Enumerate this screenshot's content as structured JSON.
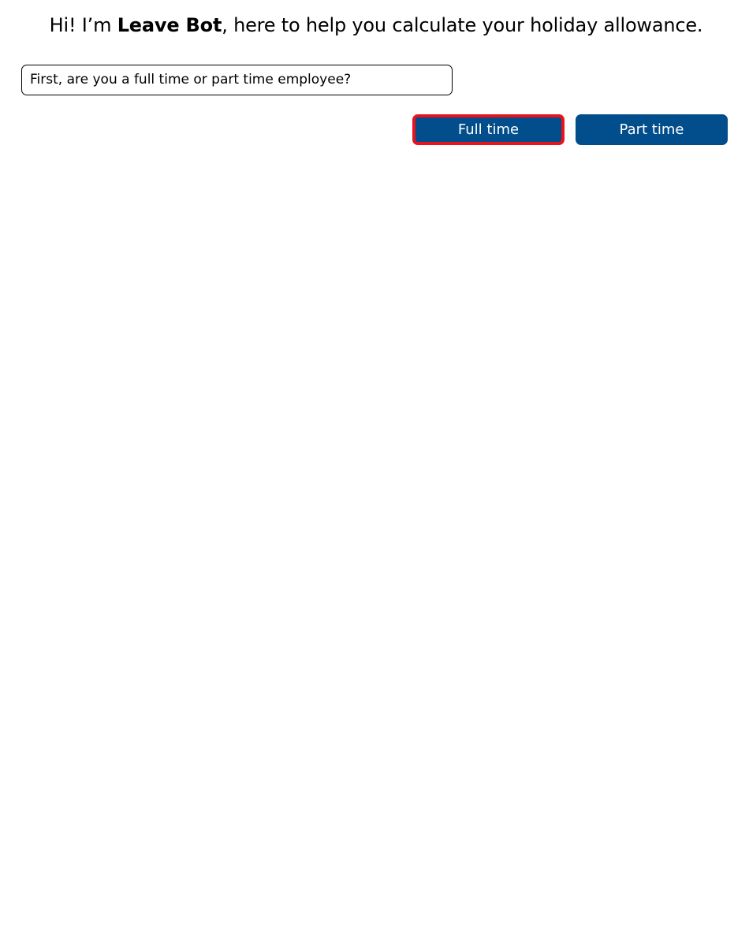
{
  "header": {
    "greeting_prefix": "Hi! I’m ",
    "bot_name": "Leave Bot",
    "greeting_suffix": ", here to help you calculate your holiday allowance."
  },
  "chat": {
    "bot_message": "First, are you a full time or part time employee?"
  },
  "choices": {
    "full_time_label": "Full time",
    "part_time_label": "Part time"
  },
  "colors": {
    "button_background": "#024d8b",
    "button_text": "#ffffff",
    "highlight_border": "#e8141c"
  }
}
